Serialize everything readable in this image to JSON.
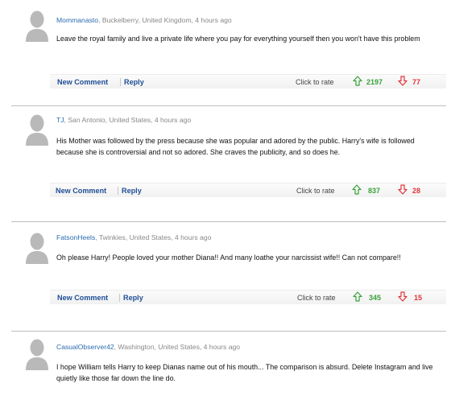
{
  "comments": [
    {
      "user": "Mommanasto",
      "location": ", Buckelberry, United Kingdom, 4 hours ago",
      "text": "Leave the royal family and live a private life where you pay for everything yourself then you won't have this problem",
      "new_comment": "New Comment",
      "reply": "Reply",
      "click_to_rate": "Click to rate",
      "up": "2197",
      "down": "77"
    },
    {
      "user": "TJ",
      "location": ", San Antonio, United States, 4 hours ago",
      "text": "His Mother was followed by the press because she was popular and adored by the public. Harry's wife is followed because she is controversial and not so adored. She craves the publicity, and so does he.",
      "new_comment": "New Comment",
      "reply": "Reply",
      "click_to_rate": "Click to rate",
      "up": "837",
      "down": "28"
    },
    {
      "user": "FatsonHeels",
      "location": ", Twinkies, United States, 4 hours ago",
      "text": "Oh please Harry! People loved your mother Diana!! And many loathe your narcissist wife!! Can not compare!!",
      "new_comment": "New Comment",
      "reply": "Reply",
      "click_to_rate": "Click to rate",
      "up": "345",
      "down": "15"
    },
    {
      "user": "CasualObserver42",
      "location": ", Washington, United States, 4 hours ago",
      "text": "I hope William tells Harry to keep Dianas name out of his mouth... The comparison is absurd. Delete Instagram and live quietly like those far down the line do."
    }
  ],
  "colors": {
    "up": "#3aa23a",
    "down": "#e2333a",
    "link": "#1f4e96",
    "user": "#2b6cb0"
  },
  "icons": {
    "avatar": "default-avatar-icon",
    "up": "up-arrow-icon",
    "down": "down-arrow-icon"
  }
}
